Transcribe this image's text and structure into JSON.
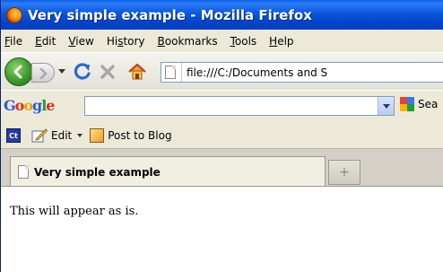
{
  "window": {
    "title": "Very simple example - Mozilla Firefox"
  },
  "menu": [
    {
      "mnemonic": "F",
      "rest": "ile"
    },
    {
      "mnemonic": "E",
      "rest": "dit"
    },
    {
      "mnemonic": "V",
      "rest": "iew"
    },
    {
      "pre": "Hi",
      "mnemonic": "s",
      "rest": "tory"
    },
    {
      "mnemonic": "B",
      "rest": "ookmarks"
    },
    {
      "mnemonic": "T",
      "rest": "ools"
    },
    {
      "mnemonic": "H",
      "rest": "elp"
    }
  ],
  "navigation": {
    "url": "file:///C:/Documents and S"
  },
  "google_toolbar": {
    "logo": [
      "G",
      "o",
      "o",
      "g",
      "l",
      "e"
    ],
    "search_value": "",
    "search_label": "Sea"
  },
  "blog_toolbar": {
    "edit_label": "Edit",
    "post_label": "Post to Blog",
    "ct_badge": "Ct"
  },
  "tabs": {
    "active_title": "Very simple example",
    "new_tab_glyph": "+"
  },
  "page": {
    "text": "This will appear as is."
  },
  "colors": {
    "title_bar": "#0b56dc",
    "chrome": "#ece9d8",
    "back_button": "#3c9a2c"
  }
}
